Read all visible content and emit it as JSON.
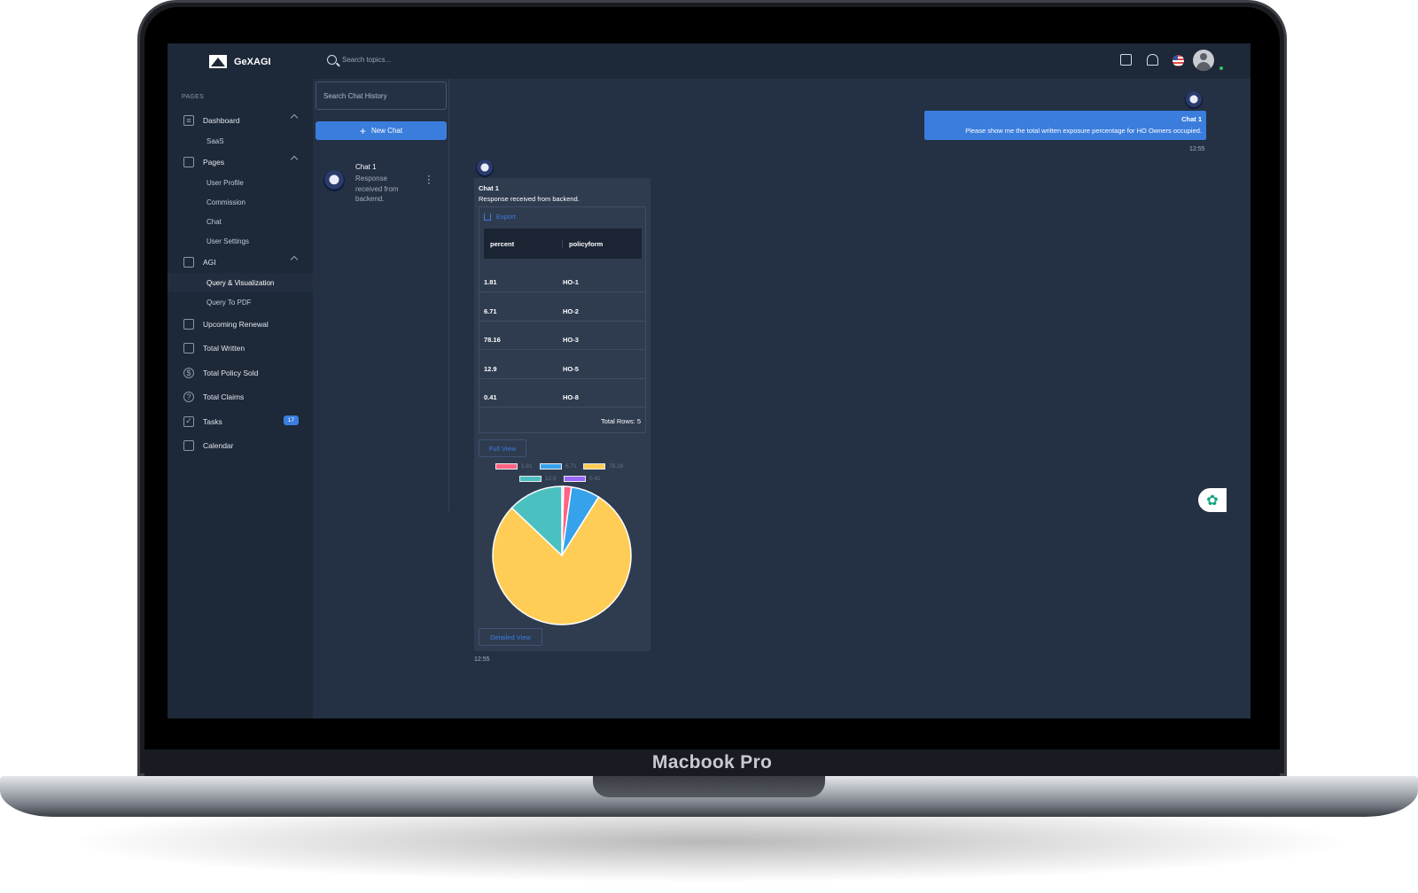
{
  "device": {
    "brand": "Macbook Pro"
  },
  "app": {
    "name": "GeXAGI"
  },
  "sidebar": {
    "section_label": "PAGES",
    "dashboard": {
      "label": "Dashboard",
      "icon": "sliders-icon",
      "children": [
        "SaaS"
      ]
    },
    "pages": {
      "label": "Pages",
      "icon": "layout-icon",
      "children": [
        "User Profile",
        "Commission",
        "Chat",
        "User Settings"
      ]
    },
    "agi": {
      "label": "AGI",
      "icon": "briefcase-icon",
      "children": [
        "Query & Visualization",
        "Query To PDF"
      ],
      "active_child": "Query & Visualization"
    },
    "items": [
      {
        "label": "Upcoming Renewal",
        "icon": "book-icon"
      },
      {
        "label": "Total Written",
        "icon": "card-icon"
      },
      {
        "label": "Total Policy Sold",
        "icon": "dollar-icon"
      },
      {
        "label": "Total Claims",
        "icon": "help-icon"
      },
      {
        "label": "Tasks",
        "icon": "check-square-icon",
        "badge": "17"
      },
      {
        "label": "Calendar",
        "icon": "calendar-icon"
      }
    ]
  },
  "topbar": {
    "search_placeholder": "Search topics..."
  },
  "chat_panel": {
    "search_placeholder": "Search Chat History",
    "new_chat_label": "New Chat",
    "chats": [
      {
        "title": "Chat 1",
        "preview": "Response received from backend."
      }
    ]
  },
  "conversation": {
    "user_message": {
      "title": "Chat 1",
      "text": "Please show me the total written exposure percentage for HO Owners occupied.",
      "time": "12:55"
    },
    "bot_message": {
      "title": "Chat 1",
      "text": "Response received from backend.",
      "export_label": "Export",
      "columns": [
        "percent",
        "policyform"
      ],
      "rows": [
        [
          "1.81",
          "HO-1"
        ],
        [
          "6.71",
          "HO-2"
        ],
        [
          "78.16",
          "HO-3"
        ],
        [
          "12.9",
          "HO-5"
        ],
        [
          "0.41",
          "HO-8"
        ]
      ],
      "total_rows_label": "Total Rows: 5",
      "full_view_label": "Full View",
      "detailed_view_label": "Detailed View",
      "time": "12:55"
    }
  },
  "chart_data": {
    "type": "pie",
    "categories": [
      "1.81",
      "6.71",
      "78.16",
      "12.9",
      "0.41"
    ],
    "values": [
      0.41,
      1.81,
      6.71,
      78.16,
      12.9
    ],
    "value_order_labels": [
      "0.41",
      "1.81",
      "6.71",
      "78.16",
      "12.9"
    ],
    "colors": [
      "#9966ff",
      "#ff6384",
      "#36a2eb",
      "#ffcd56",
      "#4bc0c0"
    ],
    "legend": [
      {
        "label": "1.81",
        "color": "#ff6384"
      },
      {
        "label": "6.71",
        "color": "#36a2eb"
      },
      {
        "label": "78.16",
        "color": "#ffcd56"
      },
      {
        "label": "12.9",
        "color": "#4bc0c0"
      },
      {
        "label": "0.41",
        "color": "#9966ff"
      }
    ],
    "legend_position": "top"
  }
}
